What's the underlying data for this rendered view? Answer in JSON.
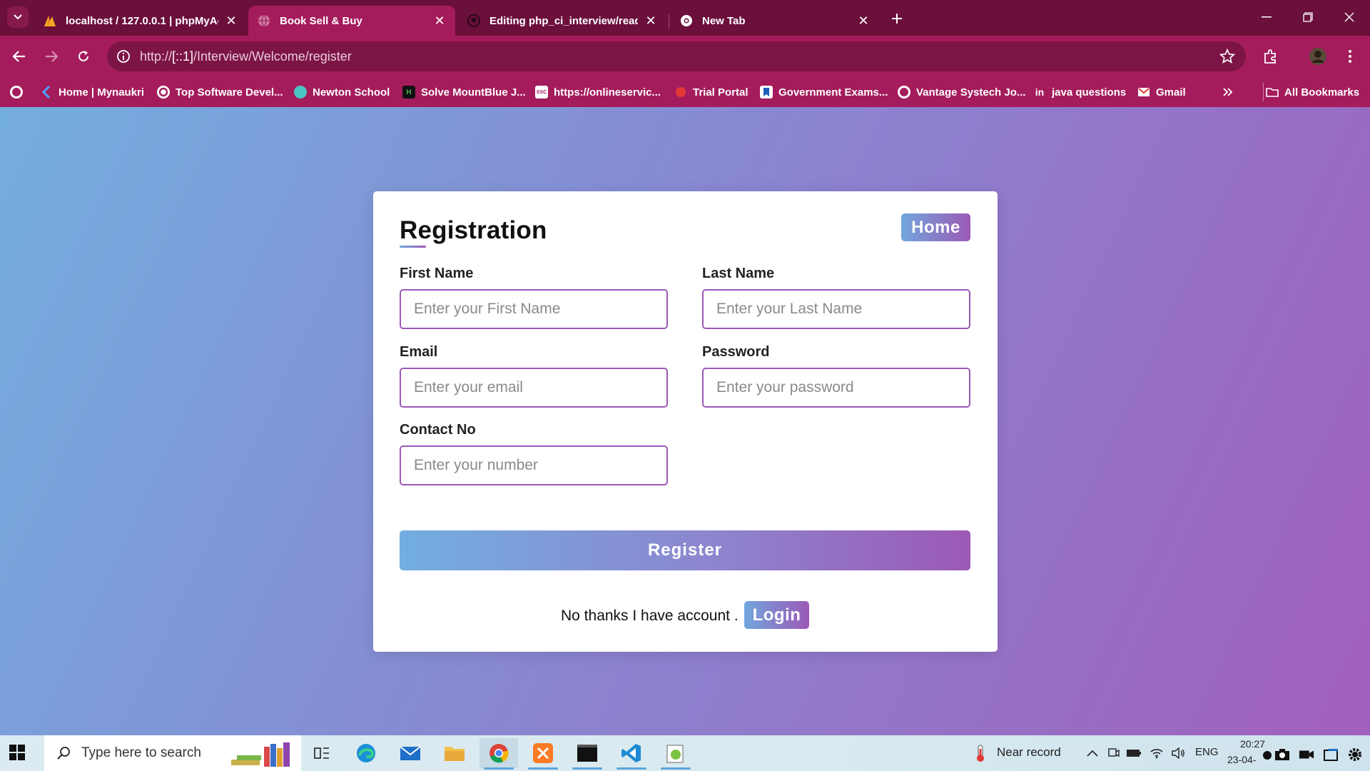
{
  "browser": {
    "tabs": [
      {
        "title": "localhost / 127.0.0.1 | phpMyAc",
        "active": false
      },
      {
        "title": "Book Sell & Buy",
        "active": true
      },
      {
        "title": "Editing php_ci_interview/readm",
        "active": false
      },
      {
        "title": "New Tab",
        "active": false
      }
    ],
    "url_prefix": "http://",
    "url_host": "[::1]",
    "url_path": "/Interview/Welcome/register",
    "bookmarks": [
      {
        "label": "Home | Mynaukri"
      },
      {
        "label": "Top Software Devel..."
      },
      {
        "label": "Newton School"
      },
      {
        "label": "Solve MountBlue J..."
      },
      {
        "label": "https://onlineservic..."
      },
      {
        "label": "Trial Portal"
      },
      {
        "label": "Government Exams..."
      },
      {
        "label": "Vantage Systech Jo..."
      },
      {
        "label": "java questions"
      },
      {
        "label": "Gmail"
      }
    ],
    "all_bookmarks": "All Bookmarks",
    "accent": "#a41c5c"
  },
  "form": {
    "title": "Registration",
    "home_label": "Home",
    "first_name": {
      "label": "First Name",
      "placeholder": "Enter your First Name",
      "value": ""
    },
    "last_name": {
      "label": "Last Name",
      "placeholder": "Enter your Last Name",
      "value": ""
    },
    "email": {
      "label": "Email",
      "placeholder": "Enter your email",
      "value": ""
    },
    "password": {
      "label": "Password",
      "placeholder": "Enter your password",
      "value": ""
    },
    "contact": {
      "label": "Contact No",
      "placeholder": "Enter your number",
      "value": ""
    },
    "register_label": "Register",
    "account_text": "No thanks I have account .",
    "login_label": "Login",
    "gradient_start": "#72a6dc",
    "gradient_end": "#9b59b6"
  },
  "taskbar": {
    "search_placeholder": "Type here to search",
    "weather": "Near record",
    "language": "ENG",
    "time": "20:27",
    "date": "23-04-"
  }
}
